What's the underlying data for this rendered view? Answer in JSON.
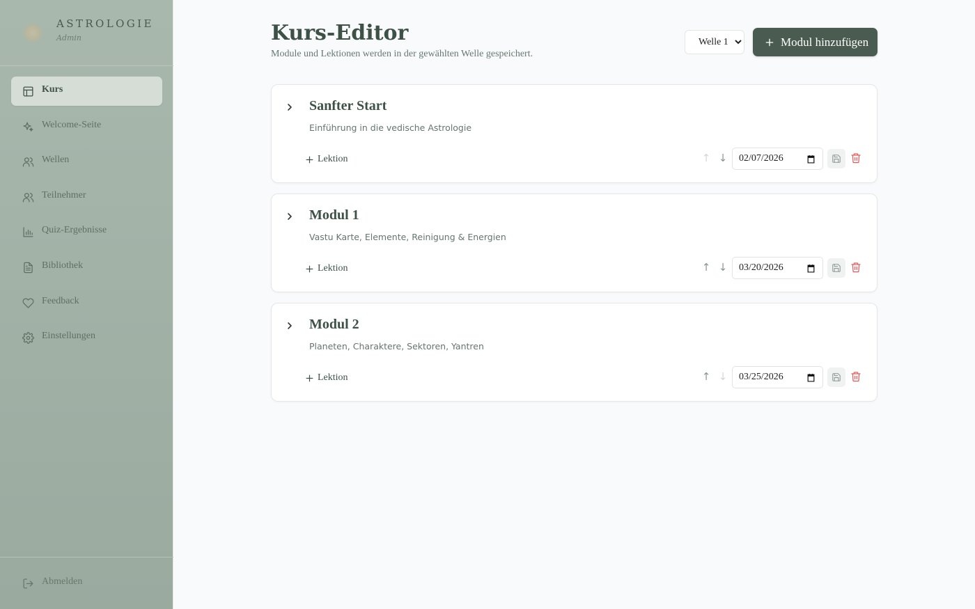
{
  "brand": {
    "title": "ASTROLOGIE",
    "subtitle": "Admin"
  },
  "sidebar": {
    "items": [
      {
        "label": "Kurs",
        "icon": "layout-icon",
        "active": true
      },
      {
        "label": "Welcome-Seite",
        "icon": "sparkles-icon"
      },
      {
        "label": "Wellen",
        "icon": "users-icon"
      },
      {
        "label": "Teilnehmer",
        "icon": "users-icon"
      },
      {
        "label": "Quiz-Ergebnisse",
        "icon": "bar-chart-icon"
      },
      {
        "label": "Bibliothek",
        "icon": "document-icon"
      },
      {
        "label": "Feedback",
        "icon": "heart-icon"
      },
      {
        "label": "Einstellungen",
        "icon": "gear-icon"
      }
    ],
    "logout_label": "Abmelden"
  },
  "header": {
    "title": "Kurs-Editor",
    "subtitle": "Module und Lektionen werden in der gewählten Welle gespeichert.",
    "wave_selected": "Welle 1",
    "add_module_label": "Modul hinzufügen"
  },
  "modules": [
    {
      "title": "Sanfter Start",
      "description": "Einführung in die vedische Astrologie",
      "add_lesson_label": "Lektion",
      "date": "02/07/2026",
      "up_enabled": false,
      "down_enabled": true
    },
    {
      "title": "Modul 1",
      "description": "Vastu Karte, Elemente, Reinigung & Energien",
      "add_lesson_label": "Lektion",
      "date": "03/20/2026",
      "up_enabled": true,
      "down_enabled": true
    },
    {
      "title": "Modul 2",
      "description": "Planeten, Charaktere, Sektoren, Yantren",
      "add_lesson_label": "Lektion",
      "date": "03/25/2026",
      "up_enabled": true,
      "down_enabled": false
    }
  ],
  "colors": {
    "accent": "#4a5c52",
    "danger": "#e25c5c",
    "sidebar": "#a3b2a7"
  }
}
